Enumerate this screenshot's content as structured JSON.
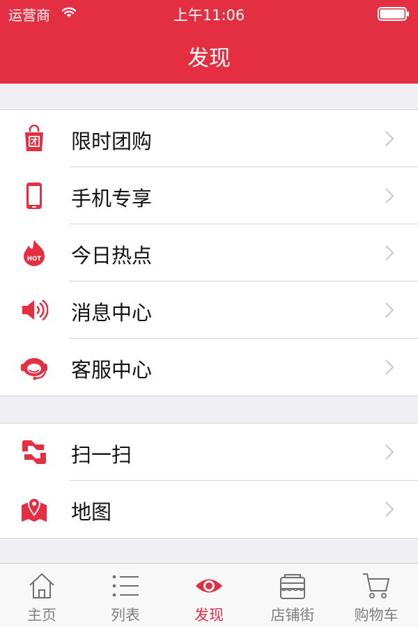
{
  "status_bar": {
    "carrier": "运营商",
    "time": "上午11:06"
  },
  "header": {
    "title": "发现"
  },
  "accent_color": "#e42f42",
  "menu_groups": [
    [
      {
        "label": "限时团购",
        "icon": "shopping-bag-icon"
      },
      {
        "label": "手机专享",
        "icon": "mobile-phone-icon"
      },
      {
        "label": "今日热点",
        "icon": "hot-flame-icon"
      },
      {
        "label": "消息中心",
        "icon": "speaker-icon"
      },
      {
        "label": "客服中心",
        "icon": "customer-service-icon"
      }
    ],
    [
      {
        "label": "扫一扫",
        "icon": "scan-icon"
      },
      {
        "label": "地图",
        "icon": "map-icon"
      }
    ]
  ],
  "tabs": [
    {
      "label": "主页",
      "icon": "home-icon",
      "active": false
    },
    {
      "label": "列表",
      "icon": "list-icon",
      "active": false
    },
    {
      "label": "发现",
      "icon": "eye-icon",
      "active": true
    },
    {
      "label": "店铺街",
      "icon": "store-icon",
      "active": false
    },
    {
      "label": "购物车",
      "icon": "cart-icon",
      "active": false
    }
  ]
}
